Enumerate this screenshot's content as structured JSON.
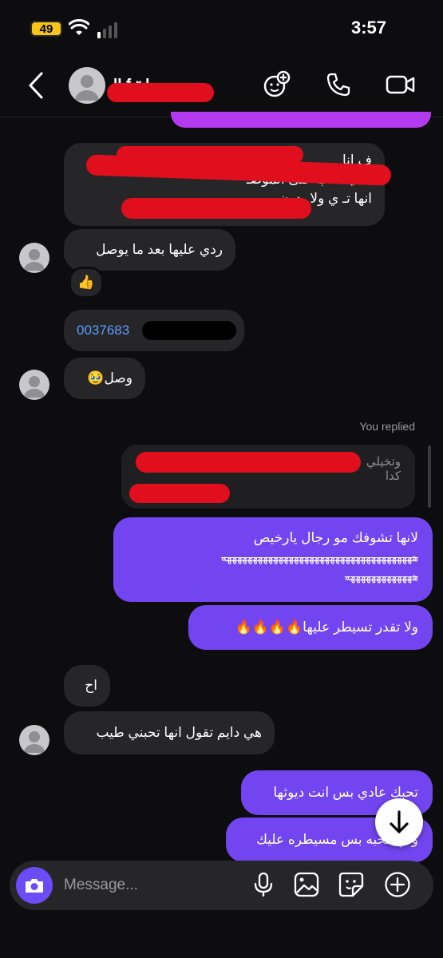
{
  "status_bar": {
    "time": "3:57",
    "battery": "49"
  },
  "header": {
    "name": "ll f r l"
  },
  "messages": {
    "m1_line1": "انا",
    "m1_line2": "يسحب على الموضـ",
    "m1_line3": "انها تـ",
    "m1_line3b": "ي ولا بدون",
    "m1_right1": "ف",
    "m1_right2": "ف",
    "m2": "ردي عليها بعد ما يوصل",
    "m2_reaction": "👍",
    "m3": "0037683",
    "m4": "وصل🥹",
    "replied_label": "You replied",
    "quoted_text": "وتخيلي",
    "quoted_text2": "كدا",
    "m5_line1": "لانها تشوفك مو رجال يارخيص",
    "m5_line2": "هههههههههههههههههههههههههههههههههههههه",
    "m5_line3": "هههههههههههههه",
    "m6": "ولا تقدر تسيطر عليها🔥🔥🔥🔥",
    "m7": "اح",
    "m8": "هي دايم تقول انها تحبني طيب",
    "m9": "تحبك عادي بس انت ديوثها",
    "m10": "ولي فحبه بس مسيطره عليك"
  },
  "composer": {
    "placeholder": "Message..."
  },
  "colors": {
    "outgoing": "#7345f0",
    "incoming": "#262628",
    "redaction": "#e10f1e",
    "accent": "#6b4cf5"
  }
}
